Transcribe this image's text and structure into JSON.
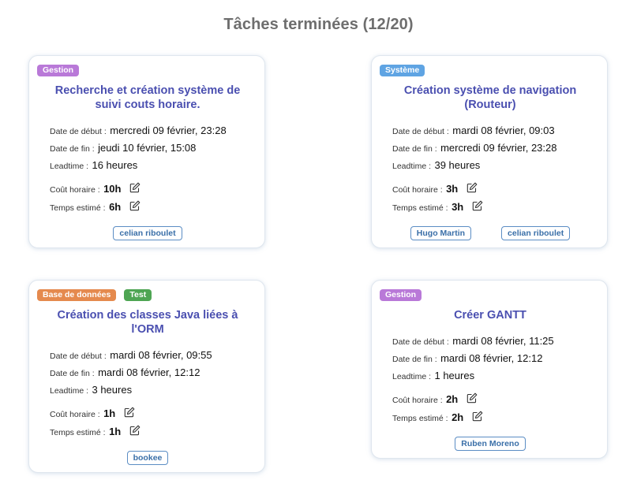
{
  "page_title": "Tâches terminées (12/20)",
  "labels": {
    "start": "Date de début :",
    "end": "Date de fin :",
    "leadtime": "Leadtime :",
    "hourly_cost": "Coût horaire :",
    "estimated_time": "Temps estimé :"
  },
  "tag_colors": {
    "Gestion": "#b979d8",
    "Système": "#5fa4e3",
    "Base de données": "#e58a4e",
    "Test": "#4ea553"
  },
  "title_color": "#4a4fb0",
  "cards": [
    {
      "tags": [
        "Gestion"
      ],
      "title": "Recherche et création système de suivi couts horaire.",
      "start": "mercredi 09 février, 23:28",
      "end": "jeudi 10 février, 15:08",
      "leadtime": "16 heures",
      "hourly_cost": "10h",
      "estimated_time": "6h",
      "users": [
        "celian riboulet"
      ]
    },
    {
      "tags": [
        "Système"
      ],
      "title": "Création système de navigation (Routeur)",
      "start": "mardi 08 février, 09:03",
      "end": "mercredi 09 février, 23:28",
      "leadtime": "39 heures",
      "hourly_cost": "3h",
      "estimated_time": "3h",
      "users": [
        "Hugo Martin",
        "celian riboulet"
      ]
    },
    {
      "tags": [
        "Base de données",
        "Test"
      ],
      "title": "Création des classes Java liées à l'ORM",
      "start": "mardi 08 février, 09:55",
      "end": "mardi 08 février, 12:12",
      "leadtime": "3 heures",
      "hourly_cost": "1h",
      "estimated_time": "1h",
      "users": [
        "bookee"
      ]
    },
    {
      "tags": [
        "Gestion"
      ],
      "title": "Créer GANTT",
      "start": "mardi 08 février, 11:25",
      "end": "mardi 08 février, 12:12",
      "leadtime": "1 heures",
      "hourly_cost": "2h",
      "estimated_time": "2h",
      "users": [
        "Ruben Moreno"
      ]
    }
  ]
}
